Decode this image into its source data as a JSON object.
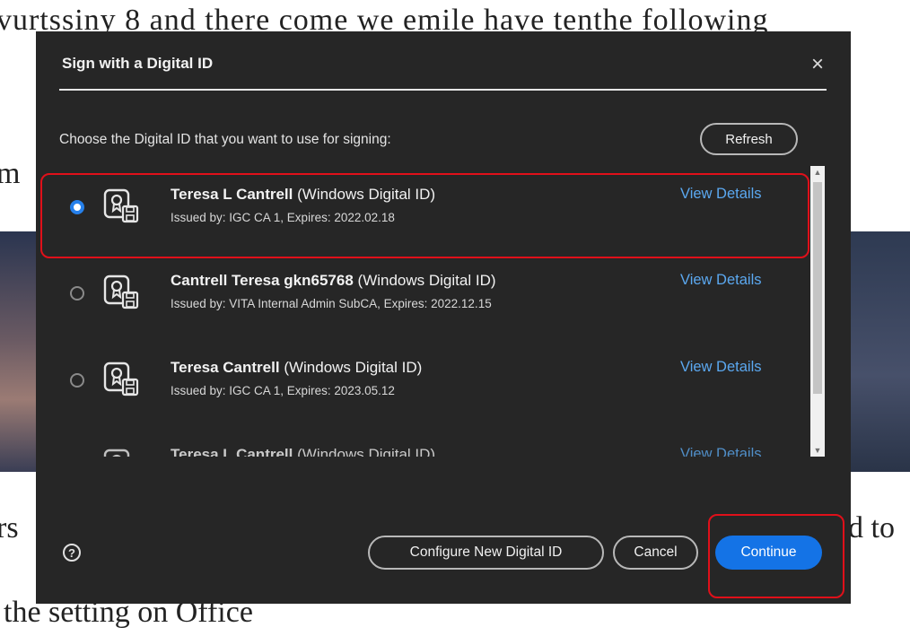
{
  "background": {
    "line1": "vurtssiny 8 and there come we emile have tenthe following",
    "line2": "m",
    "line3": "rs",
    "line3_right": "d to",
    "line4": "the setting on Office"
  },
  "dialog": {
    "title": "Sign with a Digital ID",
    "close_glyph": "×",
    "instruction": "Choose the Digital ID that you want to use for signing:",
    "refresh_label": "Refresh",
    "ids": [
      {
        "name": "Teresa L Cantrell",
        "type": "(Windows Digital ID)",
        "issuer": "Issued by: IGC CA 1, Expires: 2022.02.18",
        "view": "View Details",
        "selected": true
      },
      {
        "name": "Cantrell Teresa gkn65768",
        "type": "(Windows Digital ID)",
        "issuer": "Issued by: VITA Internal Admin SubCA, Expires: 2022.12.15",
        "view": "View Details",
        "selected": false
      },
      {
        "name": "Teresa Cantrell",
        "type": "(Windows Digital ID)",
        "issuer": "Issued by: IGC CA 1, Expires: 2023.05.12",
        "view": "View Details",
        "selected": false
      },
      {
        "name": "Teresa L Cantrell",
        "type": "(Windows Digital ID)",
        "issuer": "",
        "view": "View Details",
        "selected": false
      }
    ],
    "help_glyph": "?",
    "configure_label": "Configure New Digital ID",
    "cancel_label": "Cancel",
    "continue_label": "Continue",
    "scroll_up_glyph": "▲",
    "scroll_down_glyph": "▼"
  },
  "colors": {
    "dialog_bg": "#262626",
    "accent": "#1473e6",
    "link": "#5ba8f0",
    "annotation": "#e0101a"
  },
  "icons": [
    "certificate-icon",
    "close-icon",
    "help-icon",
    "scroll-up-icon",
    "scroll-down-icon"
  ]
}
